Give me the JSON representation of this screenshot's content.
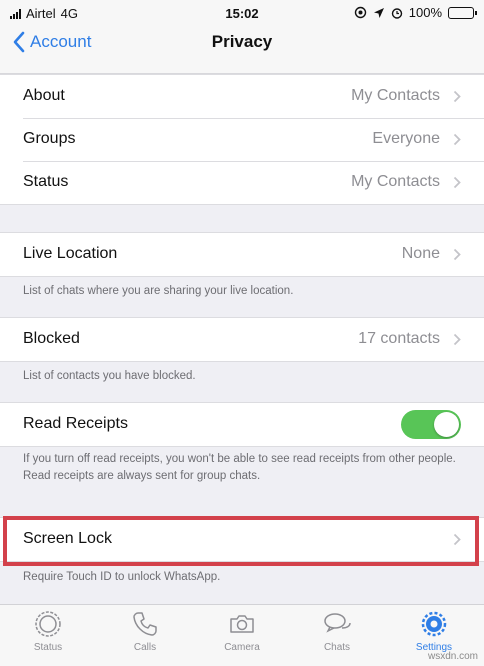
{
  "status_bar": {
    "carrier": "Airtel",
    "network": "4G",
    "time": "15:02",
    "battery": "100%",
    "battery_level": 1.0
  },
  "nav": {
    "back_label": "Account",
    "title": "Privacy"
  },
  "privacy": {
    "items": [
      {
        "label": "About",
        "value": "My Contacts"
      },
      {
        "label": "Groups",
        "value": "Everyone"
      },
      {
        "label": "Status",
        "value": "My Contacts"
      }
    ],
    "live_location": {
      "label": "Live Location",
      "value": "None",
      "footer": "List of chats where you are sharing your live location."
    },
    "blocked": {
      "label": "Blocked",
      "value": "17 contacts",
      "footer": "List of contacts you have blocked."
    },
    "read_receipts": {
      "label": "Read Receipts",
      "enabled": true,
      "footer": "If you turn off read receipts, you won't be able to see read receipts from other people. Read receipts are always sent for group chats."
    },
    "screen_lock": {
      "label": "Screen Lock",
      "footer": "Require Touch ID to unlock WhatsApp."
    }
  },
  "tabs": [
    {
      "label": "Status",
      "icon": "status-icon"
    },
    {
      "label": "Calls",
      "icon": "phone-icon"
    },
    {
      "label": "Camera",
      "icon": "camera-icon"
    },
    {
      "label": "Chats",
      "icon": "chats-icon"
    },
    {
      "label": "Settings",
      "icon": "gear-icon",
      "active": true
    }
  ],
  "colors": {
    "accent": "#2f7ee6",
    "toggle_on": "#58c557",
    "highlight": "#d3414b",
    "background": "#efeff4"
  },
  "watermark": "wsxdn.com"
}
